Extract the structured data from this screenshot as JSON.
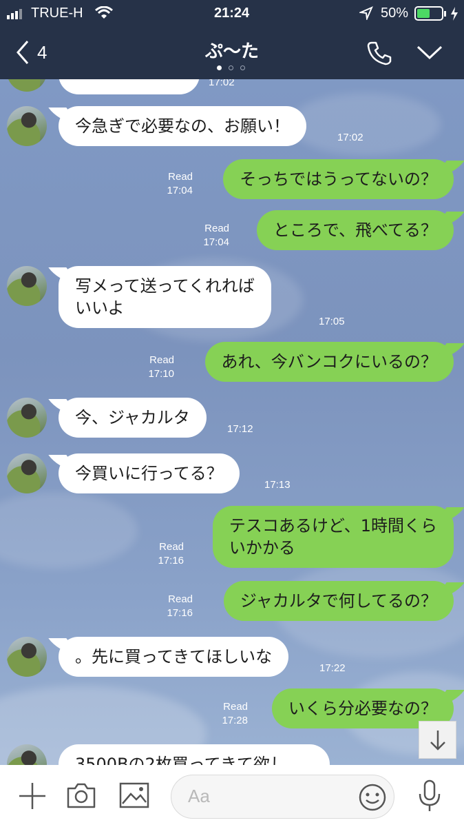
{
  "status": {
    "carrier": "TRUE-H",
    "time": "21:24",
    "battery": "50%"
  },
  "nav": {
    "back_count": "4",
    "title": "ぷ〜た"
  },
  "messages": [
    {
      "side": "in",
      "text": "",
      "time": "17:02"
    },
    {
      "side": "in",
      "text": "今急ぎで必要なの、お願い！",
      "time": "17:02"
    },
    {
      "side": "out",
      "text": "そっちではうってないの？",
      "read": "Read",
      "time": "17:04"
    },
    {
      "side": "out",
      "text": "ところで、飛べてる？",
      "read": "Read",
      "time": "17:04"
    },
    {
      "side": "in",
      "text": "写メって送ってくれれば\nいいよ",
      "time": "17:05"
    },
    {
      "side": "out",
      "text": "あれ、今バンコクにいるの？",
      "read": "Read",
      "time": "17:10"
    },
    {
      "side": "in",
      "text": "今、ジャカルタ",
      "time": "17:12"
    },
    {
      "side": "in",
      "text": "今買いに行ってる？",
      "time": "17:13"
    },
    {
      "side": "out",
      "text": "テスコあるけど、1時間くら\nいかかる",
      "read": "Read",
      "time": "17:16"
    },
    {
      "side": "out",
      "text": "ジャカルタで何してるの？",
      "read": "Read",
      "time": "17:16"
    },
    {
      "side": "in",
      "text": "。先に買ってきてほしいな",
      "time": "17:22"
    },
    {
      "side": "out",
      "text": "いくら分必要なの？",
      "read": "Read",
      "time": "17:28"
    },
    {
      "side": "in",
      "text": "3500Bの2枚買ってきて欲し",
      "time": ""
    }
  ],
  "input": {
    "placeholder": "Aa"
  }
}
